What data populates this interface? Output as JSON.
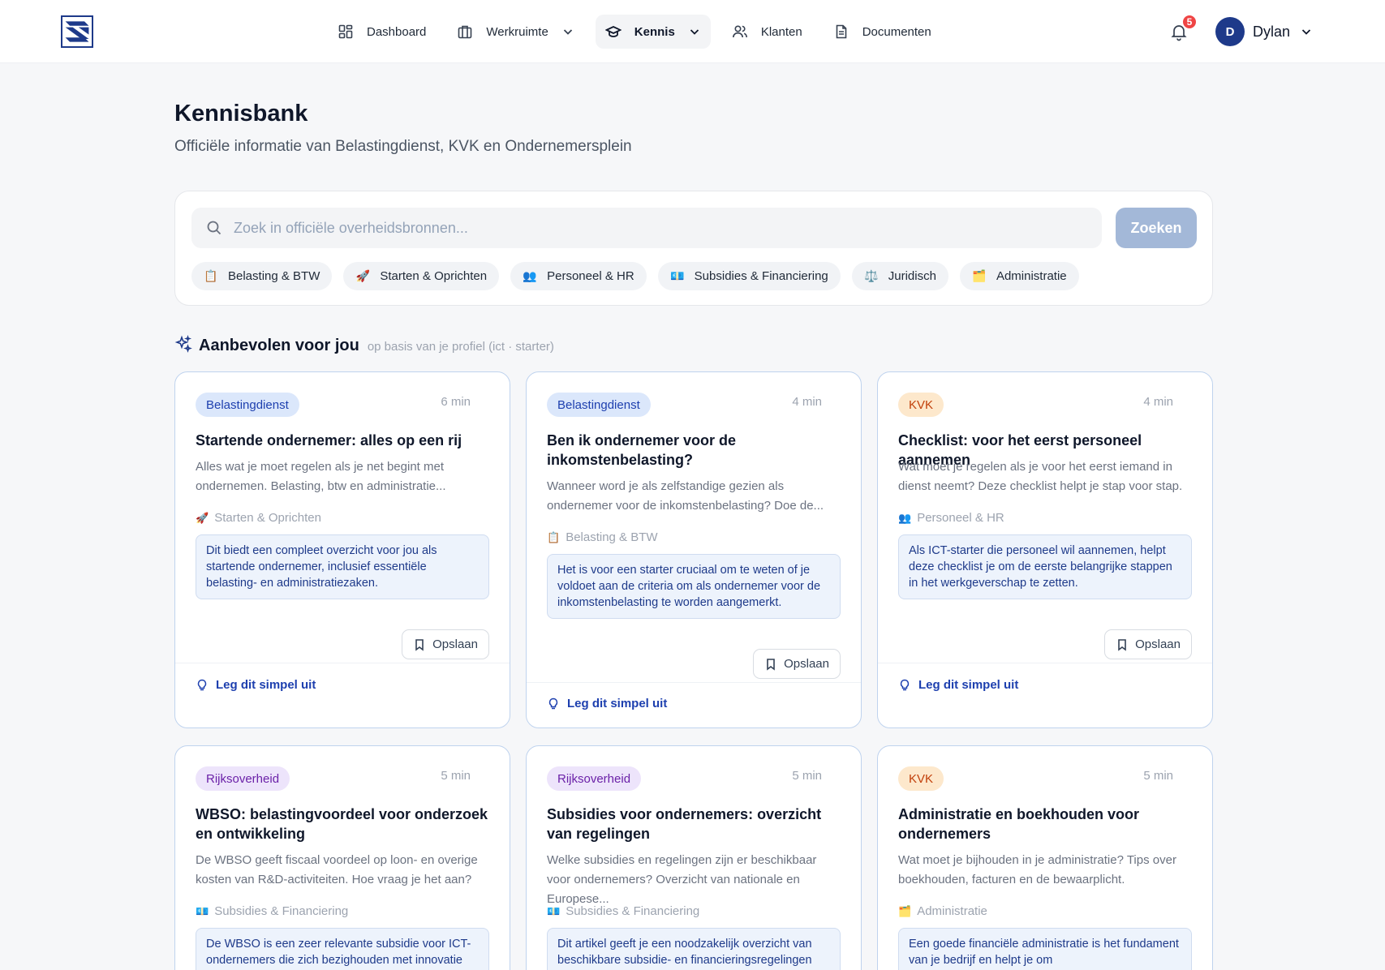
{
  "nav": {
    "items": [
      {
        "label": "Dashboard"
      },
      {
        "label": "Werkruimte"
      },
      {
        "label": "Kennis"
      },
      {
        "label": "Klanten"
      },
      {
        "label": "Documenten"
      }
    ],
    "notifications": "5",
    "user": {
      "initial": "D",
      "name": "Dylan"
    }
  },
  "page": {
    "title": "Kennisbank",
    "subtitle": "Officiële informatie van Belastingdienst, KVK en Ondernemersplein"
  },
  "search": {
    "placeholder": "Zoek in officiële overheidsbronnen...",
    "button": "Zoeken",
    "chips": [
      {
        "emoji": "📋",
        "label": "Belasting & BTW"
      },
      {
        "emoji": "🚀",
        "label": "Starten & Oprichten"
      },
      {
        "emoji": "👥",
        "label": "Personeel & HR"
      },
      {
        "emoji": "💶",
        "label": "Subsidies & Financiering"
      },
      {
        "emoji": "⚖️",
        "label": "Juridisch"
      },
      {
        "emoji": "🗂️",
        "label": "Administratie"
      }
    ]
  },
  "recommended": {
    "title": "Aanbevolen voor jou",
    "note": "op basis van je profiel (ict · starter)",
    "cards": [
      {
        "source": "Belastingdienst",
        "minutes": "6 min",
        "title": "Startende ondernemer: alles op een rij",
        "description": "Alles wat je moet regelen als je net begint met ondernemen. Belasting, btw en administratie...",
        "category_emoji": "🚀",
        "category": "Starten & Oprichten",
        "why": "Dit biedt een compleet overzicht voor jou als startende ondernemer, inclusief essentiële belasting- en administratiezaken.",
        "save": "Opslaan",
        "explain": "Leg dit simpel uit"
      },
      {
        "source": "Belastingdienst",
        "minutes": "4 min",
        "title": "Ben ik ondernemer voor de inkomstenbelasting?",
        "description": "Wanneer word je als zelfstandige gezien als ondernemer voor de inkomstenbelasting? Doe de...",
        "category_emoji": "📋",
        "category": "Belasting & BTW",
        "why": "Het is voor een starter cruciaal om te weten of je voldoet aan de criteria om als ondernemer voor de inkomstenbelasting te worden aangemerkt.",
        "save": "Opslaan",
        "explain": "Leg dit simpel uit"
      },
      {
        "source": "KVK",
        "minutes": "4 min",
        "title": "Checklist: voor het eerst personeel aannemen",
        "description": "Wat moet je regelen als je voor het eerst iemand in dienst neemt? Deze checklist helpt je stap voor stap.",
        "category_emoji": "👥",
        "category": "Personeel & HR",
        "why": "Als ICT-starter die personeel wil aannemen, helpt deze checklist je om de eerste belangrijke stappen in het werkgeverschap te zetten.",
        "save": "Opslaan",
        "explain": "Leg dit simpel uit"
      },
      {
        "source": "Rijksoverheid",
        "minutes": "5 min",
        "title": "WBSO: belastingvoordeel voor onderzoek en ontwikkeling",
        "description": "De WBSO geeft fiscaal voordeel op loon- en overige kosten van R&D-activiteiten. Hoe vraag je het aan?",
        "category_emoji": "💶",
        "category": "Subsidies & Financiering",
        "why": "De WBSO is een zeer relevante subsidie voor ICT-ondernemers die zich bezighouden met innovatie"
      },
      {
        "source": "Rijksoverheid",
        "minutes": "5 min",
        "title": "Subsidies voor ondernemers: overzicht van regelingen",
        "description": "Welke subsidies en regelingen zijn er beschikbaar voor ondernemers? Overzicht van nationale en Europese...",
        "category_emoji": "💶",
        "category": "Subsidies & Financiering",
        "why": "Dit artikel geeft je een noodzakelijk overzicht van beschikbare subsidie- en financieringsregelingen"
      },
      {
        "source": "KVK",
        "minutes": "5 min",
        "title": "Administratie en boekhouden voor ondernemers",
        "description": "Wat moet je bijhouden in je administratie? Tips over boekhouden, facturen en de bewaarplicht.",
        "category_emoji": "🗂️",
        "category": "Administratie",
        "why": "Een goede financiële administratie is het fundament van je bedrijf en helpt je om"
      }
    ]
  },
  "colors": {
    "brand": "#1e3a8a",
    "accent": "#1e40af",
    "badge_red": "#ef4444",
    "search_button": "#a3b8d8"
  }
}
